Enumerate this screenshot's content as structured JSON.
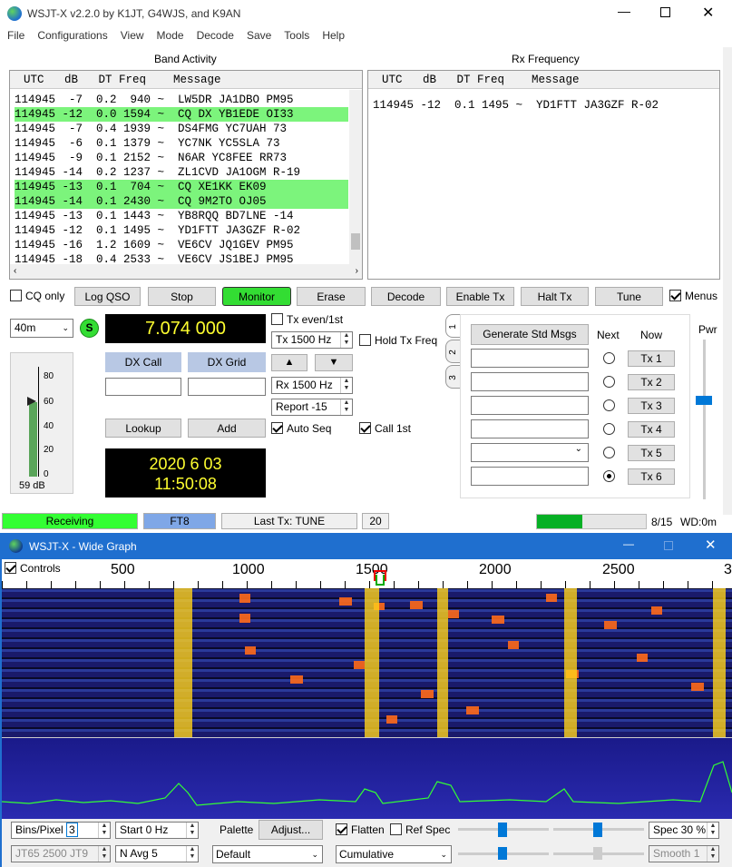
{
  "window": {
    "title": "WSJT-X   v2.2.0   by K1JT, G4WJS, and K9AN"
  },
  "menu": [
    "File",
    "Configurations",
    "View",
    "Mode",
    "Decode",
    "Save",
    "Tools",
    "Help"
  ],
  "band_activity": {
    "title": "Band Activity",
    "header": "  UTC   dB   DT Freq    Message",
    "rows": [
      {
        "text": "114945  -7  0.2  940 ~  LW5DR JA1DBO PM95",
        "hl": false
      },
      {
        "text": "114945 -12  0.0 1594 ~  CQ DX YB1EDE OI33",
        "hl": true
      },
      {
        "text": "114945  -7  0.4 1939 ~  DS4FMG YC7UAH 73",
        "hl": false
      },
      {
        "text": "114945  -6  0.1 1379 ~  YC7NK YC5SLA 73",
        "hl": false
      },
      {
        "text": "114945  -9  0.1 2152 ~  N6AR YC8FEE RR73",
        "hl": false
      },
      {
        "text": "114945 -14  0.2 1237 ~  ZL1CVD JA1OGM R-19",
        "hl": false
      },
      {
        "text": "114945 -13  0.1  704 ~  CQ XE1KK EK09",
        "hl": true
      },
      {
        "text": "114945 -14  0.1 2430 ~  CQ 9M2TO OJ05",
        "hl": true
      },
      {
        "text": "114945 -13  0.1 1443 ~  YB8RQQ BD7LNE -14",
        "hl": false
      },
      {
        "text": "114945 -12  0.1 1495 ~  YD1FTT JA3GZF R-02",
        "hl": false
      },
      {
        "text": "114945 -16  1.2 1609 ~  VE6CV JQ1GEV PM95",
        "hl": false
      },
      {
        "text": "114945 -18  0.4 2533 ~  VE6CV JS1BEJ PM95",
        "hl": false
      }
    ]
  },
  "rx_frequency": {
    "title": "Rx Frequency",
    "header": "  UTC   dB   DT Freq    Message",
    "rows": [
      "114945 -12  0.1 1495 ~  YD1FTT JA3GZF R-02"
    ]
  },
  "controls": {
    "cq_only": "CQ only",
    "log_qso": "Log QSO",
    "stop": "Stop",
    "monitor": "Monitor",
    "erase": "Erase",
    "decode": "Decode",
    "enable_tx": "Enable Tx",
    "halt_tx": "Halt Tx",
    "tune": "Tune",
    "menus": "Menus"
  },
  "band": "40m",
  "s_label": "S",
  "frequency": "7.074 000",
  "dx_call": "DX Call",
  "dx_grid": "DX Grid",
  "lookup": "Lookup",
  "add": "Add",
  "date": "2020 6 03",
  "time": "11:50:08",
  "level": {
    "label": "59 dB",
    "ticks": [
      "80",
      "60",
      "40",
      "20",
      "0"
    ],
    "value": 59
  },
  "tx_even": "Tx even/1st",
  "tx_freq": "Tx  1500  Hz",
  "rx_freq": "Rx  1500  Hz",
  "hold_tx": "Hold Tx Freq",
  "report": "Report -15",
  "auto_seq": "Auto Seq",
  "call_1st": "Call 1st",
  "tabs": [
    "1",
    "2",
    "3"
  ],
  "gen_std": "Generate Std Msgs",
  "next": "Next",
  "now": "Now",
  "tx_buttons": [
    "Tx 1",
    "Tx 2",
    "Tx 3",
    "Tx 4",
    "Tx 5",
    "Tx 6"
  ],
  "pwr": "Pwr",
  "statusbar": {
    "receiving": "Receiving",
    "mode": "FT8",
    "last_tx": "Last Tx: TUNE",
    "period": "20",
    "progress": "8/15",
    "wd": "WD:0m",
    "progress_frac": 0.42
  },
  "wide_graph": {
    "title": "WSJT-X - Wide Graph",
    "controls": "Controls",
    "scale": [
      "500",
      "1000",
      "1500",
      "2000",
      "2500",
      "3"
    ],
    "bins": "Bins/Pixel",
    "bins_val": "3",
    "start": "Start 0 Hz",
    "palette": "Palette",
    "adjust": "Adjust...",
    "flatten": "Flatten",
    "ref_spec": "Ref Spec",
    "spec": "Spec 30 %",
    "jt": "JT65  2500  JT9",
    "navg": "N Avg 5",
    "default": "Default",
    "cumulative": "Cumulative",
    "smooth": "Smooth  1"
  },
  "colors": {
    "highlight": "#7cf47c",
    "monitor": "#33dd33",
    "lcd": "#000000",
    "lcd_text": "#ffff30",
    "graph_title": "#1f6fcf"
  }
}
